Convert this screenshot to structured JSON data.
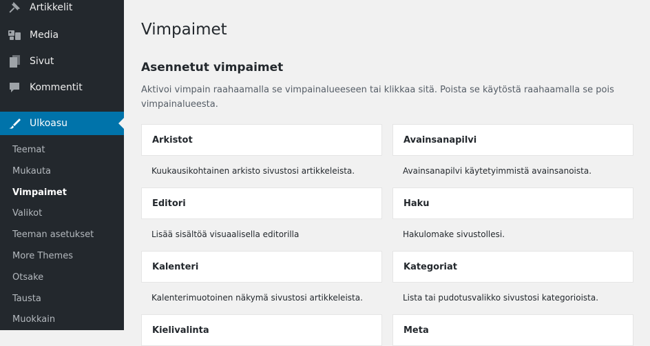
{
  "sidebar": {
    "top_items": [
      {
        "label": "Artikkelit",
        "icon": "pin-icon"
      },
      {
        "label": "Media",
        "icon": "media-icon"
      },
      {
        "label": "Sivut",
        "icon": "pages-icon"
      },
      {
        "label": "Kommentit",
        "icon": "comments-icon"
      },
      {
        "label": "Ulkoasu",
        "icon": "appearance-icon"
      }
    ],
    "submenu": [
      "Teemat",
      "Mukauta",
      "Vimpaimet",
      "Valikot",
      "Teeman asetukset",
      "More Themes",
      "Otsake",
      "Tausta",
      "Muokkain"
    ],
    "current_submenu": "Vimpaimet",
    "colors": {
      "bg": "#23282d",
      "active": "#0073aa"
    }
  },
  "main": {
    "title": "Vimpaimet",
    "section_title": "Asennetut vimpaimet",
    "description": "Aktivoi vimpain raahaamalla se vimpainalueeseen tai klikkaa sitä. Poista se käytöstä raahaamalla se pois vimpainalueesta.",
    "widgets": [
      {
        "name": "Arkistot",
        "desc": "Kuukausikohtainen arkisto sivustosi artikkeleista."
      },
      {
        "name": "Avainsanapilvi",
        "desc": "Avainsanapilvi käytetyimmistä avainsanoista."
      },
      {
        "name": "Editori",
        "desc": "Lisää sisältöä visuaalisella editorilla"
      },
      {
        "name": "Haku",
        "desc": "Hakulomake sivustollesi."
      },
      {
        "name": "Kalenteri",
        "desc": "Kalenterimuotoinen näkymä sivustosi artikkeleista."
      },
      {
        "name": "Kategoriat",
        "desc": "Lista tai pudotusvalikko sivustosi kategorioista."
      },
      {
        "name": "Kielivalinta",
        "desc": ""
      },
      {
        "name": "Meta",
        "desc": ""
      }
    ]
  }
}
